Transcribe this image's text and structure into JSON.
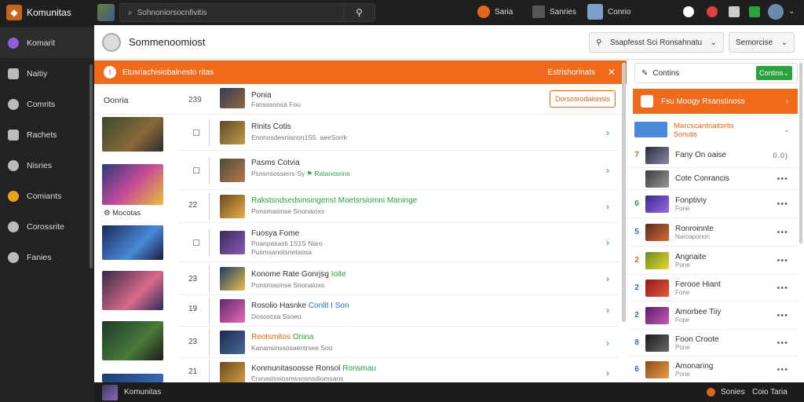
{
  "app": {
    "name": "Komunitas"
  },
  "topbar": {
    "search_placeholder": "Sohnoniorsocnfivitis",
    "nav1": "Saria",
    "nav2": "Sanries",
    "nav3": "Conrio"
  },
  "sidebar": {
    "items": [
      {
        "label": "Komarit",
        "icon": "community-icon"
      },
      {
        "label": "Naitiy",
        "icon": "news-icon"
      },
      {
        "label": "Comrits",
        "icon": "chat-icon"
      },
      {
        "label": "Rachets",
        "icon": "tools-icon"
      },
      {
        "label": "Nisries",
        "icon": "history-icon"
      },
      {
        "label": "Comiants",
        "icon": "coins-icon"
      },
      {
        "label": "Corossrite",
        "icon": "settings-icon"
      },
      {
        "label": "Fanies",
        "icon": "info-icon"
      }
    ]
  },
  "header": {
    "title": "Sommenoomiost",
    "select1": "Ssapfesst Sci Ronsahnatu",
    "select2": "Semorcise"
  },
  "banner": {
    "text": "Etusriachisiobalnesto ritas",
    "right": "Estrishorinats"
  },
  "list": {
    "header_label": "Oonria",
    "header_num": "239",
    "header_title": "Ponia",
    "header_sub": "Fansssoosa Fou",
    "header_btn": "Dorsosrodaionsts",
    "side_label": "Mocotas",
    "rows": [
      {
        "num": "",
        "title": "Rinits Cotis",
        "sub": "Enonosdesnisnon1S5. aeeSorrk",
        "chev": "›"
      },
      {
        "num": "",
        "title": "Pasms Cotvia",
        "title2": "Ratanosrins",
        "sub": "Psnsnsosserrs Sy",
        "chev": "›"
      },
      {
        "num": "22",
        "title": "Rakstsndsedsinsingenst Moetsrsiomni Maninge",
        "sub": "Ponsmasinse Snonaioxs",
        "chev": "›",
        "green": true
      },
      {
        "num": "",
        "title": "Fuosya Fome",
        "sub": "Poanpasasti 1S1S Naro",
        "sub2": "Pusmsanotsnetaosa",
        "chev": "›"
      },
      {
        "num": "23",
        "title": "Konome Rate Gonrjsg",
        "title2": "Ioite",
        "sub": "Ponsmasinse Snonaioxs",
        "chev": "›"
      },
      {
        "num": "19",
        "title": "Rosolio Hasnke",
        "title2": "Conlit I Son",
        "sub": "Dososcsa Ssoeo",
        "chev": "›"
      },
      {
        "num": "23",
        "title": "Reotsmitos",
        "title2": "Onina",
        "sub": "Kanansinssosaentrsee Soo",
        "chev": "›"
      },
      {
        "num": "21",
        "title": "Konmunitasoosse Ronsol",
        "title2": "Ronsmau",
        "sub": "Ersnasissiosmssnsnsdiomsans",
        "chev": "›"
      }
    ]
  },
  "right": {
    "top_label": "Contins",
    "top_btn": "Contins",
    "orange_text": "Fsu Moogy Rsanstinoss",
    "blue_title": "Marcscantnaitsrits",
    "blue_sub": "Sonutis",
    "items": [
      {
        "rank": "7",
        "name": "Fany On oaise",
        "sub": "",
        "extra": "0.0)",
        "color": "#e0661b"
      },
      {
        "rank": "",
        "name": "Cote Conrancis",
        "sub": "",
        "extra": "•••",
        "color": "#333"
      },
      {
        "rank": "6",
        "name": "Fonptiviy",
        "sub": "Fone",
        "extra": "•••",
        "color": "#2aa33c"
      },
      {
        "rank": "5",
        "name": "Ronroinnte",
        "sub": "Naroaponon",
        "extra": "•••",
        "color": "#2a6dcc"
      },
      {
        "rank": "2",
        "name": "Angnaite",
        "sub": "Pone",
        "extra": "•••",
        "color": "#e0661b"
      },
      {
        "rank": "2",
        "name": "Ferooe Hiant",
        "sub": "Fone",
        "extra": "•••",
        "color": "#2a6dcc"
      },
      {
        "rank": "2",
        "name": "Amorbee Tiiy",
        "sub": "Fope",
        "extra": "•••",
        "color": "#2a6dcc"
      },
      {
        "rank": "8",
        "name": "Foon Croote",
        "sub": "Pone",
        "extra": "•••",
        "color": "#2a6dcc"
      },
      {
        "rank": "6",
        "name": "Amonaring",
        "sub": "Pone",
        "extra": "•••",
        "color": "#2a6dcc"
      }
    ]
  },
  "footer": {
    "title": "Komunitas",
    "right1": "Sonies",
    "right2": "Coio Taria"
  }
}
